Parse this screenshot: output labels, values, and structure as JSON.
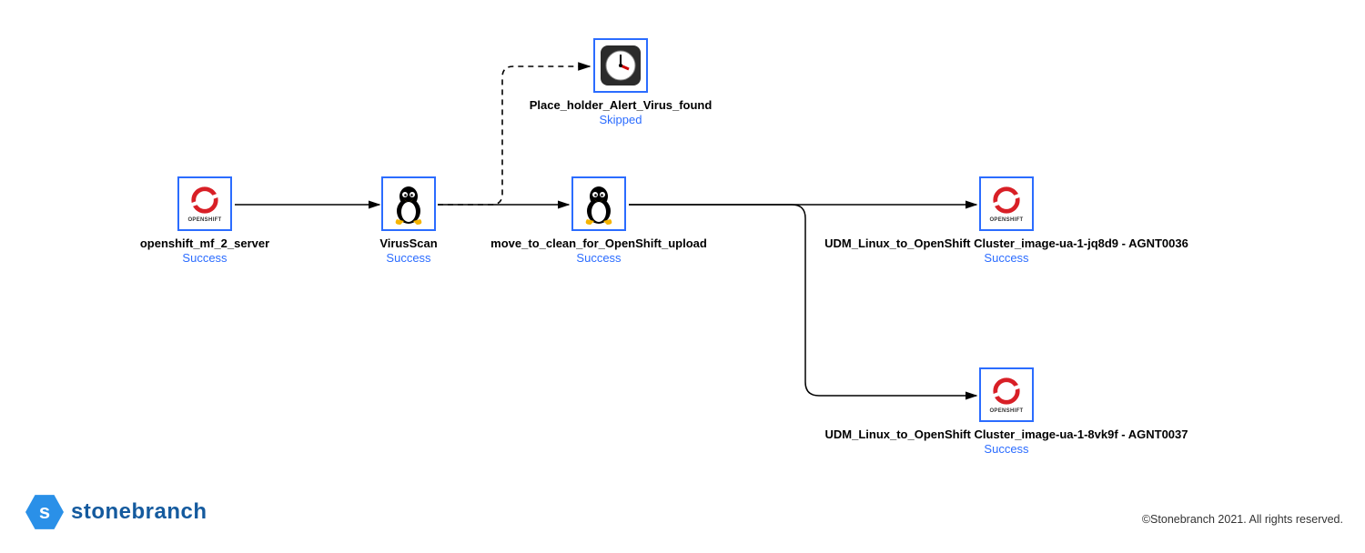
{
  "nodes": {
    "n1": {
      "label": "openshift_mf_2_server",
      "status": "Success",
      "icon": "openshift"
    },
    "n2": {
      "label": "VirusScan",
      "status": "Success",
      "icon": "linux"
    },
    "n3": {
      "label": "Place_holder_Alert_Virus_found",
      "status": "Skipped",
      "icon": "clock"
    },
    "n4": {
      "label": "move_to_clean_for_OpenShift_upload",
      "status": "Success",
      "icon": "linux"
    },
    "n5": {
      "label": "UDM_Linux_to_OpenShift Cluster_image-ua-1-jq8d9 - AGNT0036",
      "status": "Success",
      "icon": "openshift"
    },
    "n6": {
      "label": "UDM_Linux_to_OpenShift Cluster_image-ua-1-8vk9f - AGNT0037",
      "status": "Success",
      "icon": "openshift"
    }
  },
  "connectors": [
    {
      "from": "n1",
      "to": "n2",
      "style": "solid"
    },
    {
      "from": "n2",
      "to": "n4",
      "style": "solid"
    },
    {
      "from": "n2",
      "to": "n3",
      "style": "dashed"
    },
    {
      "from": "n4",
      "to": "n5",
      "style": "solid"
    },
    {
      "from": "n4",
      "to": "n6",
      "style": "solid"
    }
  ],
  "branding": {
    "logo_letter": "s",
    "logo_text": "stonebranch",
    "copyright": "©Stonebranch 2021. All rights reserved."
  },
  "icon_words": {
    "openshift": "OPENSHIFT"
  }
}
